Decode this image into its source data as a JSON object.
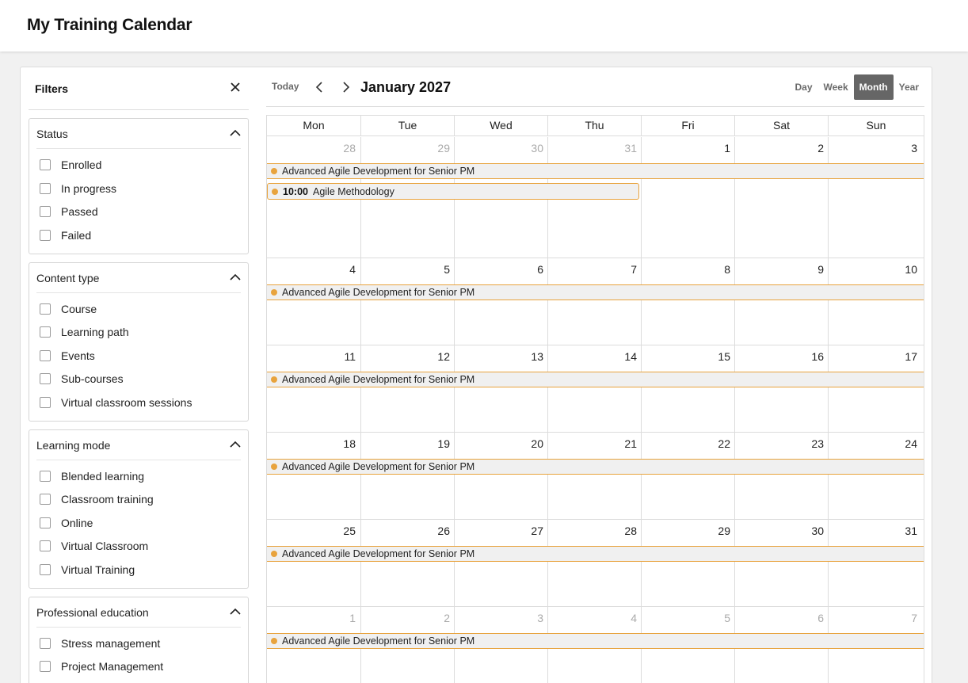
{
  "header": {
    "title": "My Training Calendar"
  },
  "filters": {
    "title": "Filters",
    "groups": [
      {
        "title": "Status",
        "items": [
          "Enrolled",
          "In progress",
          "Passed",
          "Failed"
        ]
      },
      {
        "title": "Content type",
        "items": [
          "Course",
          "Learning path",
          "Events",
          "Sub-courses",
          "Virtual classroom sessions"
        ]
      },
      {
        "title": "Learning mode",
        "items": [
          "Blended learning",
          "Classroom training",
          "Online",
          "Virtual Classroom",
          "Virtual Training"
        ]
      },
      {
        "title": "Professional education",
        "items": [
          "Stress management",
          "Project Management"
        ]
      }
    ]
  },
  "calendar": {
    "today_label": "Today",
    "month_title": "January 2027",
    "views": [
      "Day",
      "Week",
      "Month",
      "Year"
    ],
    "active_view": "Month",
    "weekdays": [
      "Mon",
      "Tue",
      "Wed",
      "Thu",
      "Fri",
      "Sat",
      "Sun"
    ],
    "weeks": [
      {
        "days": [
          "28",
          "29",
          "30",
          "31",
          "1",
          "2",
          "3"
        ],
        "other_month": [
          true,
          true,
          true,
          true,
          false,
          false,
          false
        ]
      },
      {
        "days": [
          "4",
          "5",
          "6",
          "7",
          "8",
          "9",
          "10"
        ],
        "other_month": [
          false,
          false,
          false,
          false,
          false,
          false,
          false
        ]
      },
      {
        "days": [
          "11",
          "12",
          "13",
          "14",
          "15",
          "16",
          "17"
        ],
        "other_month": [
          false,
          false,
          false,
          false,
          false,
          false,
          false
        ]
      },
      {
        "days": [
          "18",
          "19",
          "20",
          "21",
          "22",
          "23",
          "24"
        ],
        "other_month": [
          false,
          false,
          false,
          false,
          false,
          false,
          false
        ]
      },
      {
        "days": [
          "25",
          "26",
          "27",
          "28",
          "29",
          "30",
          "31"
        ],
        "other_month": [
          false,
          false,
          false,
          false,
          false,
          false,
          false
        ]
      },
      {
        "days": [
          "1",
          "2",
          "3",
          "4",
          "5",
          "6",
          "7"
        ],
        "other_month": [
          true,
          true,
          true,
          true,
          true,
          true,
          true
        ]
      }
    ],
    "events": {
      "span_event": "Advanced Agile Development for Senior PM",
      "short_event": {
        "time": "10:00",
        "title": "Agile Methodology"
      }
    },
    "event_color": "#e8a33d"
  }
}
